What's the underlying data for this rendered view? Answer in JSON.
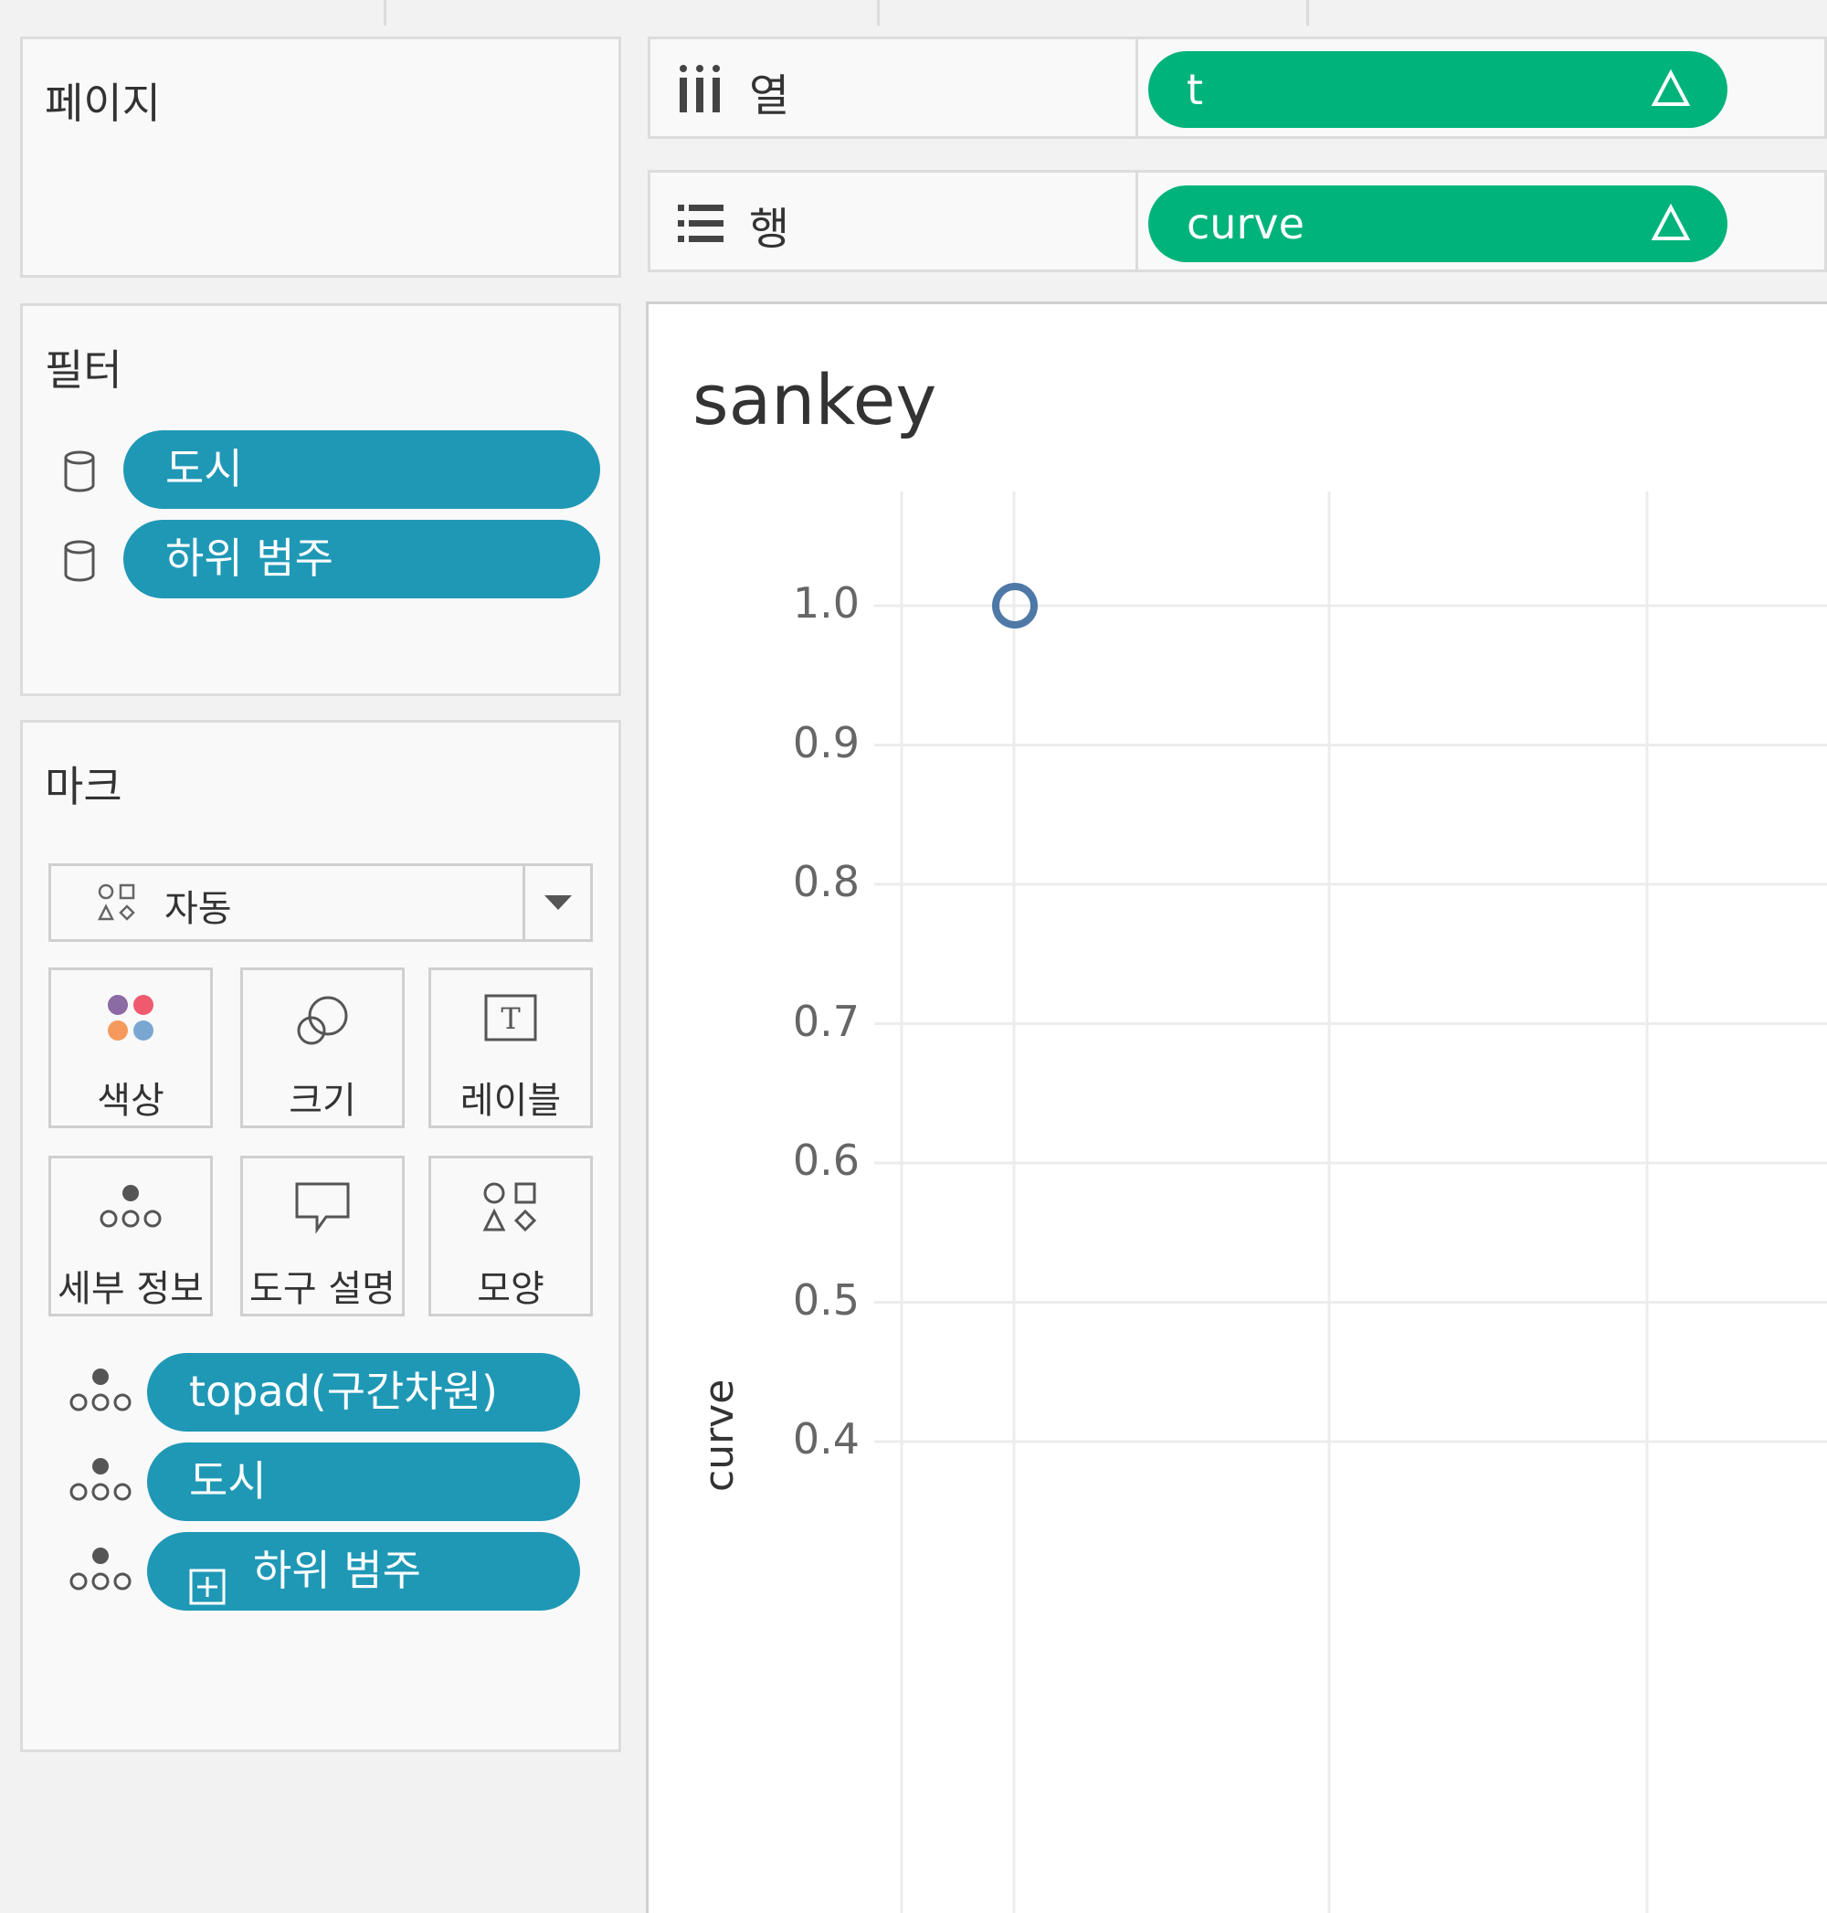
{
  "pages_panel": {
    "title": "페이지"
  },
  "filters_panel": {
    "title": "필터",
    "items": [
      {
        "label": "도시",
        "icon": "database-icon"
      },
      {
        "label": "하위 범주",
        "icon": "database-icon"
      }
    ]
  },
  "marks_panel": {
    "title": "마크",
    "mark_type": {
      "label": "자동",
      "icon": "shapes-icon"
    },
    "cards": [
      {
        "label": "색상",
        "icon": "color-dots-icon"
      },
      {
        "label": "크기",
        "icon": "size-icon"
      },
      {
        "label": "레이블",
        "icon": "label-t-icon"
      },
      {
        "label": "세부 정보",
        "icon": "detail-dots-icon"
      },
      {
        "label": "도구 설명",
        "icon": "tooltip-bubble-icon"
      },
      {
        "label": "모양",
        "icon": "shapes-icon"
      }
    ],
    "fields": [
      {
        "label": "topad(구간차원)",
        "icon": "detail-dots-icon"
      },
      {
        "label": "도시",
        "icon": "detail-dots-icon"
      },
      {
        "label": "하위 범주",
        "icon": "detail-dots-icon",
        "prefix_icon": "expand-plus-icon"
      }
    ]
  },
  "shelves": {
    "columns": {
      "label": "열",
      "icon": "columns-icon",
      "pill": "t",
      "pill_icon": "delta-triangle-icon"
    },
    "rows": {
      "label": "행",
      "icon": "rows-icon",
      "pill": "curve",
      "pill_icon": "delta-triangle-icon"
    }
  },
  "colors": {
    "dimension_pill": "#1f98b6",
    "measure_pill": "#00b37a",
    "mark": "#4e79a7"
  },
  "chart_data": {
    "type": "scatter",
    "title": "sankey",
    "ylabel": "curve",
    "xlabel": "",
    "y_ticks": [
      "1.0",
      "0.9",
      "0.8",
      "0.7",
      "0.6",
      "0.5",
      "0.4"
    ],
    "ylim": [
      0.4,
      1.0
    ],
    "grid": true,
    "marker": "open-circle",
    "points": [
      {
        "y": 1.0
      }
    ]
  }
}
